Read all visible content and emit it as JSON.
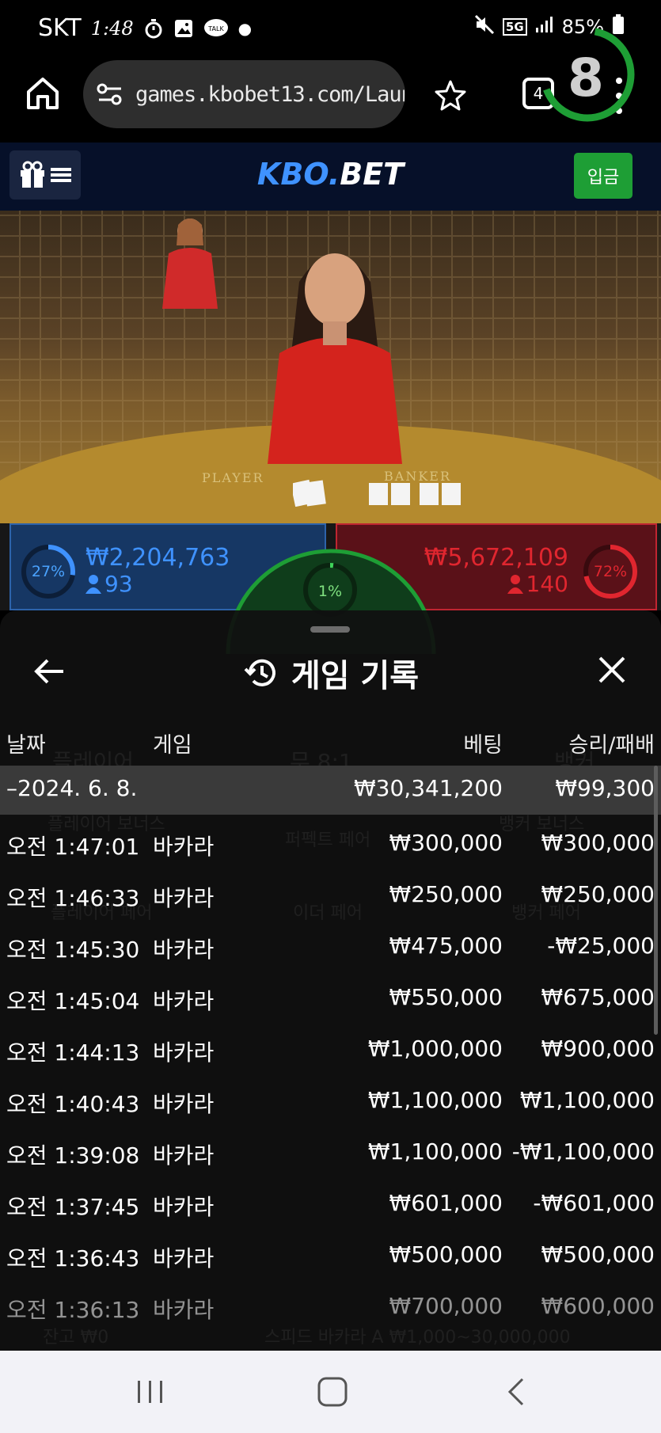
{
  "status_bar": {
    "carrier": "SKT",
    "time": "1:48",
    "talk_badge": "TALK",
    "network": "5G",
    "battery": "85%"
  },
  "browser": {
    "url": "games.kbobet13.com/Laun",
    "tab_count": "4"
  },
  "site": {
    "logo_part1": "KBO.",
    "logo_part2": "BET",
    "deposit_button": "입금"
  },
  "game": {
    "countdown": "8",
    "table_label_player": "PLAYER",
    "table_label_banker": "BANKER",
    "player_bets": {
      "percent": "27%",
      "amount": "₩2,204,763",
      "players": "93"
    },
    "banker_bets": {
      "percent": "72%",
      "amount": "₩5,672,109",
      "players": "140"
    },
    "tie_percent": "1%",
    "colors": {
      "player": "#2d63aa",
      "banker": "#c02531",
      "tie": "#1e9e35"
    }
  },
  "history": {
    "title": "게임 기록",
    "columns": {
      "date": "날짜",
      "game": "게임",
      "bet": "베팅",
      "result": "승리/패배"
    },
    "day": {
      "label": "–2024. 6. 8.",
      "total_bet": "₩30,341,200",
      "total_result": "₩99,300"
    },
    "rows": [
      {
        "time": "오전 1:47:01",
        "game": "바카라",
        "bet": "₩300,000",
        "result": "₩300,000"
      },
      {
        "time": "오전 1:46:33",
        "game": "바카라",
        "bet": "₩250,000",
        "result": "₩250,000"
      },
      {
        "time": "오전 1:45:30",
        "game": "바카라",
        "bet": "₩475,000",
        "result": "-₩25,000"
      },
      {
        "time": "오전 1:45:04",
        "game": "바카라",
        "bet": "₩550,000",
        "result": "₩675,000"
      },
      {
        "time": "오전 1:44:13",
        "game": "바카라",
        "bet": "₩1,000,000",
        "result": "₩900,000"
      },
      {
        "time": "오전 1:40:43",
        "game": "바카라",
        "bet": "₩1,100,000",
        "result": "₩1,100,000"
      },
      {
        "time": "오전 1:39:08",
        "game": "바카라",
        "bet": "₩1,100,000",
        "result": "-₩1,100,000"
      },
      {
        "time": "오전 1:37:45",
        "game": "바카라",
        "bet": "₩601,000",
        "result": "-₩601,000"
      },
      {
        "time": "오전 1:36:43",
        "game": "바카라",
        "bet": "₩500,000",
        "result": "₩500,000"
      },
      {
        "time": "오전 1:36:13",
        "game": "바카라",
        "bet": "₩700,000",
        "result": "₩600,000"
      }
    ]
  },
  "background": {
    "player": "플레이어",
    "tie": "무 8:1",
    "banker": "뱅커",
    "player_bonus": "플레이어 보너스",
    "perfect_pair": "퍼펙트 페어",
    "banker_bonus": "뱅커 보너스",
    "either_pair": "이더 페어",
    "player_pair": "플레이어 페어",
    "banker_pair": "뱅커 페어",
    "balance": "잔고 ₩0",
    "table_name": "스피드 바카라 A ₩1,000~30,000,000"
  }
}
